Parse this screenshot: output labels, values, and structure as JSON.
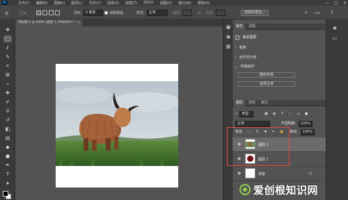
{
  "menu": {
    "app_logo": "Ps",
    "items": [
      "文件(F)",
      "编辑(E)",
      "图像(I)",
      "图层(L)",
      "文字(Y)",
      "选择(S)",
      "滤镜(T)",
      "3D(D)",
      "视图(V)",
      "窗口(W)",
      "帮助(H)"
    ],
    "window_controls": [
      "—",
      "□",
      "✕"
    ]
  },
  "options": {
    "feather_label": "羽化:",
    "feather_value": "0 像素",
    "antialias_label": "消除锯齿",
    "style_label": "样式:",
    "style_value": "正常",
    "width_label": "宽度:",
    "height_label": "高度:",
    "select_mask_button": "选择并遮住..."
  },
  "document_tab": {
    "title": "未标题-1 @ 100% (图层 2, RGB/8#) *",
    "close": "×"
  },
  "panels": {
    "top_tabs": [
      "属性",
      "调整"
    ],
    "properties": {
      "type_label": "像素图层",
      "sections": [
        "变换",
        "对齐并分布",
        "快速操作"
      ],
      "buttons": [
        "删除背景",
        "选择主体"
      ]
    },
    "layers_tabs": [
      "图层",
      "通道",
      "路径"
    ],
    "filter_kind": "类型",
    "blend_mode": "正常",
    "opacity_label": "不透明度:",
    "opacity_value": "100%",
    "lock_label": "锁定:",
    "fill_label": "填充:",
    "fill_value": "100%",
    "layers": [
      {
        "name": "图层 2",
        "selected": true
      },
      {
        "name": "图层 1",
        "selected": false
      },
      {
        "name": "背景",
        "selected": false,
        "locked": true
      }
    ]
  },
  "watermark": {
    "text": "爱创根知识网"
  },
  "colors": {
    "highlight_box": "#e84a3a",
    "workspace": "#535353",
    "panel_dark": "#3a3a3a"
  }
}
